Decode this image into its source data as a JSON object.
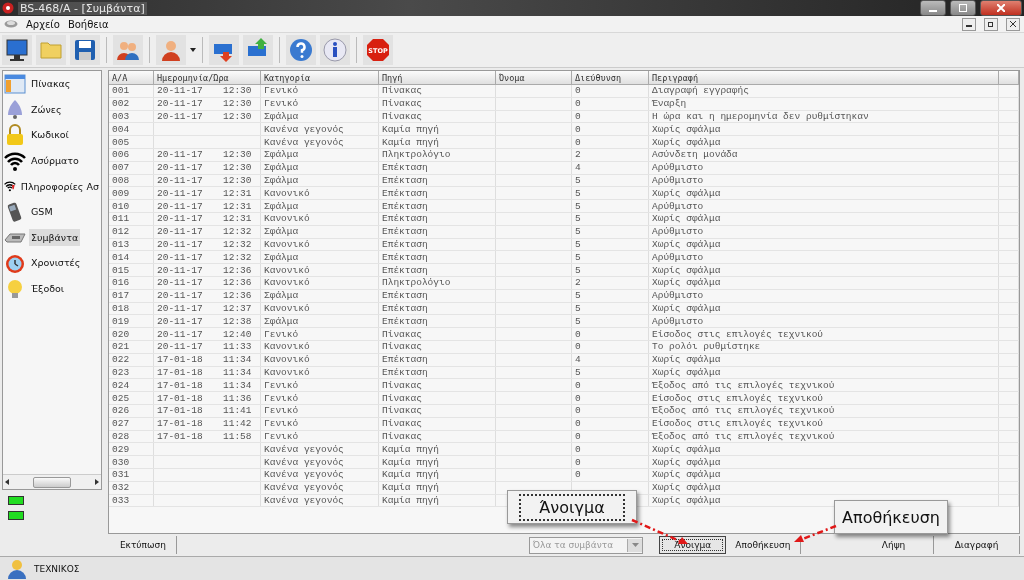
{
  "window": {
    "title": "BS-468/A - [Συμβάντα]"
  },
  "menu": [
    "Αρχείο",
    "Βοήθεια"
  ],
  "toolbar": {
    "stop_label": "STOP"
  },
  "sidebar": {
    "items": [
      {
        "label": "Πίνακας",
        "selected": false
      },
      {
        "label": "Ζώνες",
        "selected": false
      },
      {
        "label": "Κωδικοί",
        "selected": false
      },
      {
        "label": "Ασύρματο",
        "selected": false
      },
      {
        "label": "Πληροφορίες Ασ",
        "selected": false
      },
      {
        "label": "GSM",
        "selected": false
      },
      {
        "label": "Συμβάντα",
        "selected": true
      },
      {
        "label": "Χρονιστές",
        "selected": false
      },
      {
        "label": "Έξοδοι",
        "selected": false
      }
    ],
    "indicators": [
      {
        "on": true
      },
      {
        "on": true
      }
    ]
  },
  "table": {
    "columns": [
      "Α/Α",
      "Ημερομηνία/Ώρα",
      "Κατηγορία",
      "Πηγή",
      "Όνομα",
      "Διεύθυνση",
      "Περιγραφή"
    ],
    "rows": [
      {
        "aa": "001",
        "date": "20-11-17",
        "time": "12:30",
        "category": "Γενικό",
        "source": "Πίνακας",
        "address": "0",
        "description": "Διαγραφή εγγραφής"
      },
      {
        "aa": "002",
        "date": "20-11-17",
        "time": "12:30",
        "category": "Γενικό",
        "source": "Πίνακας",
        "address": "0",
        "description": "Έναρξη"
      },
      {
        "aa": "003",
        "date": "20-11-17",
        "time": "12:30",
        "category": "Σφάλμα",
        "source": "Πίνακας",
        "address": "0",
        "description": "Η ώρα και η ημερομηνία δεν ρυθμίστηκαν"
      },
      {
        "aa": "004",
        "category": "Κανένα γεγονός",
        "source": "Καμία πηγή",
        "address": "0",
        "description": "Χωρίς σφάλμα"
      },
      {
        "aa": "005",
        "category": "Κανένα γεγονός",
        "source": "Καμία πηγή",
        "address": "0",
        "description": "Χωρίς σφάλμα"
      },
      {
        "aa": "006",
        "date": "20-11-17",
        "time": "12:30",
        "category": "Σφάλμα",
        "source": "Πληκτρολόγιο",
        "address": "2",
        "description": "Ασύνδετη μονάδα"
      },
      {
        "aa": "007",
        "date": "20-11-17",
        "time": "12:30",
        "category": "Σφάλμα",
        "source": "Επέκταση",
        "address": "4",
        "description": "Αρύθμιστο"
      },
      {
        "aa": "008",
        "date": "20-11-17",
        "time": "12:30",
        "category": "Σφάλμα",
        "source": "Επέκταση",
        "address": "5",
        "description": "Αρύθμιστο"
      },
      {
        "aa": "009",
        "date": "20-11-17",
        "time": "12:31",
        "category": "Κανονικό",
        "source": "Επέκταση",
        "address": "5",
        "description": "Χωρίς σφάλμα"
      },
      {
        "aa": "010",
        "date": "20-11-17",
        "time": "12:31",
        "category": "Σφάλμα",
        "source": "Επέκταση",
        "address": "5",
        "description": "Αρύθμιστο"
      },
      {
        "aa": "011",
        "date": "20-11-17",
        "time": "12:31",
        "category": "Κανονικό",
        "source": "Επέκταση",
        "address": "5",
        "description": "Χωρίς σφάλμα"
      },
      {
        "aa": "012",
        "date": "20-11-17",
        "time": "12:32",
        "category": "Σφάλμα",
        "source": "Επέκταση",
        "address": "5",
        "description": "Αρύθμιστο"
      },
      {
        "aa": "013",
        "date": "20-11-17",
        "time": "12:32",
        "category": "Κανονικό",
        "source": "Επέκταση",
        "address": "5",
        "description": "Χωρίς σφάλμα"
      },
      {
        "aa": "014",
        "date": "20-11-17",
        "time": "12:32",
        "category": "Σφάλμα",
        "source": "Επέκταση",
        "address": "5",
        "description": "Αρύθμιστο"
      },
      {
        "aa": "015",
        "date": "20-11-17",
        "time": "12:36",
        "category": "Κανονικό",
        "source": "Επέκταση",
        "address": "5",
        "description": "Χωρίς σφάλμα"
      },
      {
        "aa": "016",
        "date": "20-11-17",
        "time": "12:36",
        "category": "Κανονικό",
        "source": "Πληκτρολόγιο",
        "address": "2",
        "description": "Χωρίς σφάλμα"
      },
      {
        "aa": "017",
        "date": "20-11-17",
        "time": "12:36",
        "category": "Σφάλμα",
        "source": "Επέκταση",
        "address": "5",
        "description": "Αρύθμιστο"
      },
      {
        "aa": "018",
        "date": "20-11-17",
        "time": "12:37",
        "category": "Κανονικό",
        "source": "Επέκταση",
        "address": "5",
        "description": "Χωρίς σφάλμα"
      },
      {
        "aa": "019",
        "date": "20-11-17",
        "time": "12:38",
        "category": "Σφάλμα",
        "source": "Επέκταση",
        "address": "5",
        "description": "Αρύθμιστο"
      },
      {
        "aa": "020",
        "date": "20-11-17",
        "time": "12:40",
        "category": "Γενικό",
        "source": "Πίνακας",
        "address": "0",
        "description": "Είσοδος στις επιλογές τεχνικού"
      },
      {
        "aa": "021",
        "date": "20-11-17",
        "time": "11:33",
        "category": "Κανονικό",
        "source": "Πίνακας",
        "address": "0",
        "description": "Το ρολόι ρυθμίστηκε"
      },
      {
        "aa": "022",
        "date": "17-01-18",
        "time": "11:34",
        "category": "Κανονικό",
        "source": "Επέκταση",
        "address": "4",
        "description": "Χωρίς σφάλμα"
      },
      {
        "aa": "023",
        "date": "17-01-18",
        "time": "11:34",
        "category": "Κανονικό",
        "source": "Επέκταση",
        "address": "5",
        "description": "Χωρίς σφάλμα"
      },
      {
        "aa": "024",
        "date": "17-01-18",
        "time": "11:34",
        "category": "Γενικό",
        "source": "Πίνακας",
        "address": "0",
        "description": "Έξοδος από τις επιλογές τεχνικού"
      },
      {
        "aa": "025",
        "date": "17-01-18",
        "time": "11:36",
        "category": "Γενικό",
        "source": "Πίνακας",
        "address": "0",
        "description": "Είσοδος στις επιλογές τεχνικού"
      },
      {
        "aa": "026",
        "date": "17-01-18",
        "time": "11:41",
        "category": "Γενικό",
        "source": "Πίνακας",
        "address": "0",
        "description": "Έξοδος από τις επιλογές τεχνικού"
      },
      {
        "aa": "027",
        "date": "17-01-18",
        "time": "11:42",
        "category": "Γενικό",
        "source": "Πίνακας",
        "address": "0",
        "description": "Είσοδος στις επιλογές τεχνικού"
      },
      {
        "aa": "028",
        "date": "17-01-18",
        "time": "11:58",
        "category": "Γενικό",
        "source": "Πίνακας",
        "address": "0",
        "description": "Έξοδος από τις επιλογές τεχνικού"
      },
      {
        "aa": "029",
        "category": "Κανένα γεγονός",
        "source": "Καμία πηγή",
        "address": "0",
        "description": "Χωρίς σφάλμα"
      },
      {
        "aa": "030",
        "category": "Κανένα γεγονός",
        "source": "Καμία πηγή",
        "address": "0",
        "description": "Χωρίς σφάλμα"
      },
      {
        "aa": "031",
        "category": "Κανένα γεγονός",
        "source": "Καμία πηγή",
        "address": "0",
        "description": "Χωρίς σφάλμα"
      },
      {
        "aa": "032",
        "category": "Κανένα γεγονός",
        "source": "Καμία πηγή",
        "description": "Χωρίς σφάλμα"
      },
      {
        "aa": "033",
        "category": "Κανένα γεγονός",
        "source": "Καμία πηγή",
        "description": "Χωρίς σφάλμα"
      }
    ]
  },
  "bottom_bar": {
    "print_button": "Εκτύπωση",
    "filter": {
      "value": "Όλα τα συμβάντα",
      "disabled": true
    },
    "buttons": [
      {
        "label": "Άνοιγμα",
        "focused": true
      },
      {
        "label": "Αποθήκευση",
        "focused": false
      },
      {
        "label": "Λήψη",
        "focused": false
      },
      {
        "label": "Διαγραφή",
        "focused": false
      }
    ]
  },
  "callouts": [
    {
      "label": "Άνοιγμα"
    },
    {
      "label": "Αποθήκευση"
    }
  ],
  "status_bar": {
    "user": "ΤΕΧΝΙΚΟΣ"
  }
}
